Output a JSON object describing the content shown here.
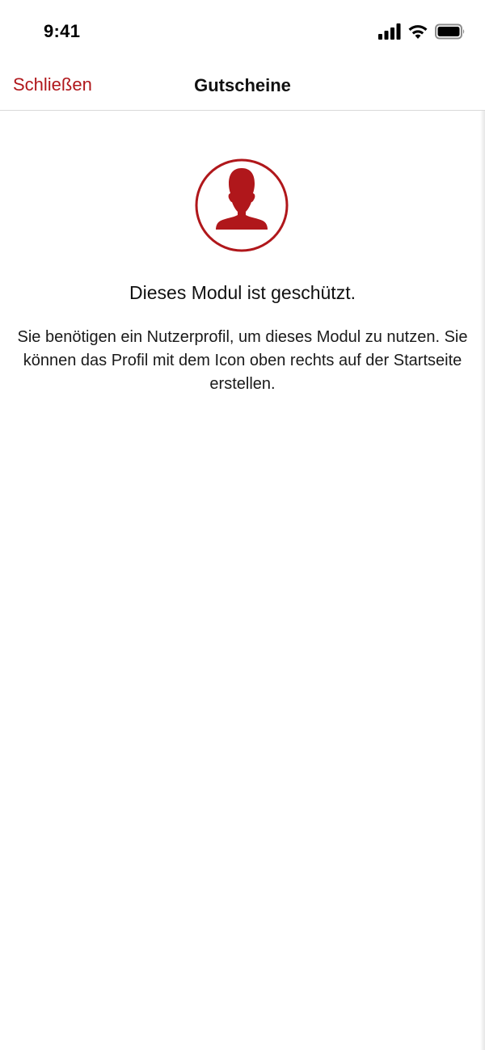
{
  "status_bar": {
    "time": "9:41",
    "icons": [
      "cellular-signal-icon",
      "wifi-icon",
      "battery-icon"
    ]
  },
  "nav": {
    "close_label": "Schließen",
    "title": "Gutscheine"
  },
  "main": {
    "icon": "user-profile-icon",
    "heading": "Dieses Modul ist geschützt.",
    "message": "Sie benötigen ein Nutzerprofil, um dieses Modul zu nutzen. Sie können das Profil mit dem Icon oben rechts auf der Startseite erstellen."
  },
  "colors": {
    "accent": "#b0171b",
    "text": "#111111",
    "background": "#ffffff"
  }
}
